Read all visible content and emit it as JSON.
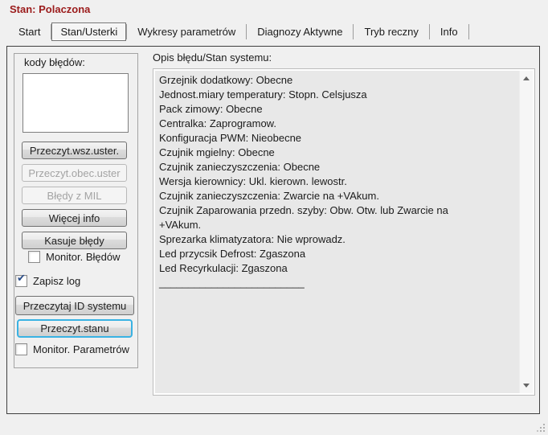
{
  "window": {
    "status": "Stan: Polaczona"
  },
  "colors": {
    "status_text": "#9b1b1b",
    "focus_ring": "#39b2e3",
    "checkmark": "#2d4f8a",
    "textarea_bg": "#e8e8e8",
    "window_bg": "#f0f0f0"
  },
  "icons": {
    "checkmark": "✔"
  },
  "tabs": {
    "items": [
      {
        "label": "Start",
        "active": false
      },
      {
        "label": "Stan/Usterki",
        "active": true
      },
      {
        "label": "Wykresy parametrów",
        "active": false
      },
      {
        "label": "Diagnozy Aktywne",
        "active": false
      },
      {
        "label": "Tryb reczny",
        "active": false
      },
      {
        "label": "Info",
        "active": false
      }
    ]
  },
  "left_panel": {
    "codes_label": "kody błędów:",
    "codes_list_items": [],
    "buttons": {
      "read_all": {
        "label": "Przeczyt.wsz.uster.",
        "enabled": true
      },
      "read_current": {
        "label": "Przeczyt.obec.uster",
        "enabled": false
      },
      "mil_errors": {
        "label": "Błędy z MIL",
        "enabled": false
      },
      "more_info": {
        "label": "Więcej info",
        "enabled": true
      },
      "clear_errors": {
        "label": "Kasuje błędy",
        "enabled": true
      },
      "read_system_id": {
        "label": "Przeczytaj ID systemu",
        "enabled": true
      },
      "read_status": {
        "label": "Przeczyt.stanu",
        "enabled": true,
        "focused": true
      }
    },
    "checkboxes": {
      "monitor_errors": {
        "label": "Monitor. Błędów",
        "checked": false
      },
      "save_log": {
        "label": "Zapisz log",
        "checked": true
      },
      "monitor_params": {
        "label": "Monitor. Parametrów",
        "checked": false
      }
    }
  },
  "status_panel": {
    "title": "Opis błędu/Stan systemu:",
    "lines": [
      "Grzejnik dodatkowy: Obecne",
      "Jednost.miary temperatury: Stopn. Celsjusza",
      "Pack zimowy: Obecne",
      "Centralka: Zaprogramow.",
      "Konfiguracja PWM: Nieobecne",
      "Czujnik mgielny: Obecne",
      "Czujnik zanieczyszczenia: Obecne",
      "Wersja kierownicy: Ukl. kierown. lewostr.",
      "Czujnik zanieczyszczenia: Zwarcie na +VAkum.",
      "Czujnik Zaparowania przedn. szyby: Obw. Otw. lub Zwarcie na",
      "+VAkum.",
      "Sprezarka klimatyzatora: Nie wprowadz.",
      "Led przycsik Defrost: Zgaszona",
      "Led Recyrkulacji: Zgaszona",
      "_________________________"
    ]
  }
}
